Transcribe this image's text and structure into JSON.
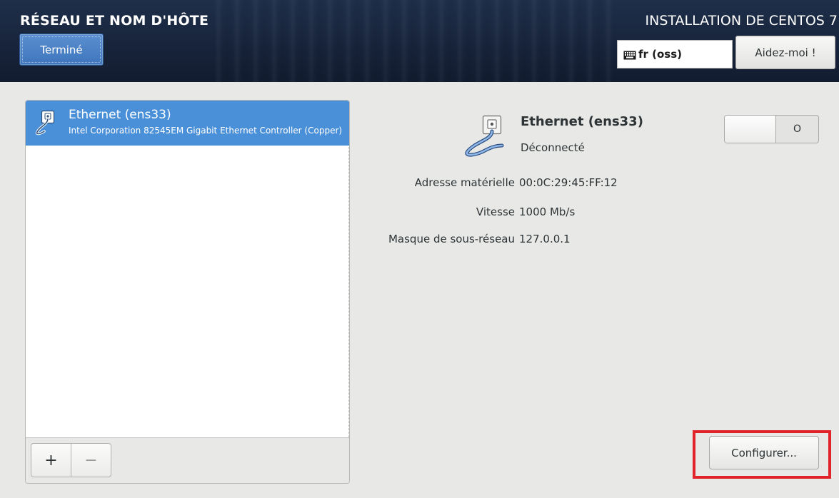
{
  "header": {
    "spoke_title": "RÉSEAU ET NOM D'HÔTE",
    "done_label": "Terminé",
    "product_title": "INSTALLATION DE CENTOS 7",
    "keyboard_layout": "fr (oss)",
    "keyboard_icon": "keyboard-icon",
    "help_label": "Aidez-moi !"
  },
  "device_list": {
    "items": [
      {
        "name": "Ethernet (ens33)",
        "description": "Intel Corporation 82545EM Gigabit Ethernet Controller (Copper)",
        "icon": "ethernet-cable-icon",
        "selected": true
      }
    ],
    "add_label": "+",
    "remove_label": "−"
  },
  "details": {
    "name": "Ethernet (ens33)",
    "status": "Déconnecté",
    "switch_state_label": "O",
    "switch_on": false,
    "properties": [
      {
        "label": "Adresse matérielle",
        "value": "00:0C:29:45:FF:12"
      },
      {
        "label": "Vitesse",
        "value": "1000 Mb/s"
      },
      {
        "label": "Masque de sous-réseau",
        "value": "127.0.0.1"
      }
    ],
    "configure_label": "Configurer..."
  },
  "colors": {
    "header_bg": "#17233a",
    "accent": "#4a90d9",
    "highlight": "#e1232a"
  }
}
